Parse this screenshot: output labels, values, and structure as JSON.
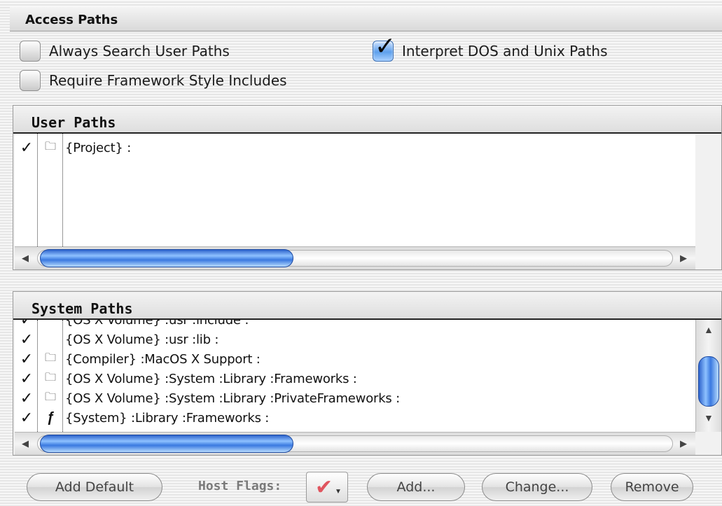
{
  "panel": {
    "title": "Access Paths"
  },
  "options": {
    "always_search_user_paths": {
      "label": "Always Search User Paths",
      "checked": false
    },
    "interpret_dos_unix_paths": {
      "label": "Interpret DOS and Unix Paths",
      "checked": true
    },
    "require_framework_includes": {
      "label": "Require Framework Style Includes",
      "checked": false
    }
  },
  "user_paths": {
    "title": "User Paths",
    "rows": [
      {
        "check": "✓",
        "icon": "folder-icon",
        "icon_glyph": "🗀",
        "path": "{Project} :"
      }
    ]
  },
  "system_paths": {
    "title": "System Paths",
    "rows": [
      {
        "check": "✓",
        "icon": "none",
        "icon_glyph": "",
        "path": "{OS X Volume} :usr :include :"
      },
      {
        "check": "✓",
        "icon": "none",
        "icon_glyph": "",
        "path": "{OS X Volume} :usr :lib :"
      },
      {
        "check": "✓",
        "icon": "folder-icon",
        "icon_glyph": "🗀",
        "path": "{Compiler} :MacOS X Support :"
      },
      {
        "check": "✓",
        "icon": "folder-icon",
        "icon_glyph": "🗀",
        "path": "{OS X Volume} :System :Library :Frameworks :"
      },
      {
        "check": "✓",
        "icon": "folder-icon",
        "icon_glyph": "🗀",
        "path": "{OS X Volume} :System :Library :PrivateFrameworks :"
      },
      {
        "check": "✓",
        "icon": "framework-icon",
        "icon_glyph": "ƒ",
        "path": "{System} :Library :Frameworks :"
      }
    ]
  },
  "footer": {
    "add_default": "Add Default",
    "host_flags_label": "Host Flags:",
    "host_flags_value_icon": "red-check-icon",
    "add": "Add...",
    "change": "Change...",
    "remove": "Remove"
  },
  "colors": {
    "accent": "#3a79e0",
    "flag": "#e0555f"
  }
}
